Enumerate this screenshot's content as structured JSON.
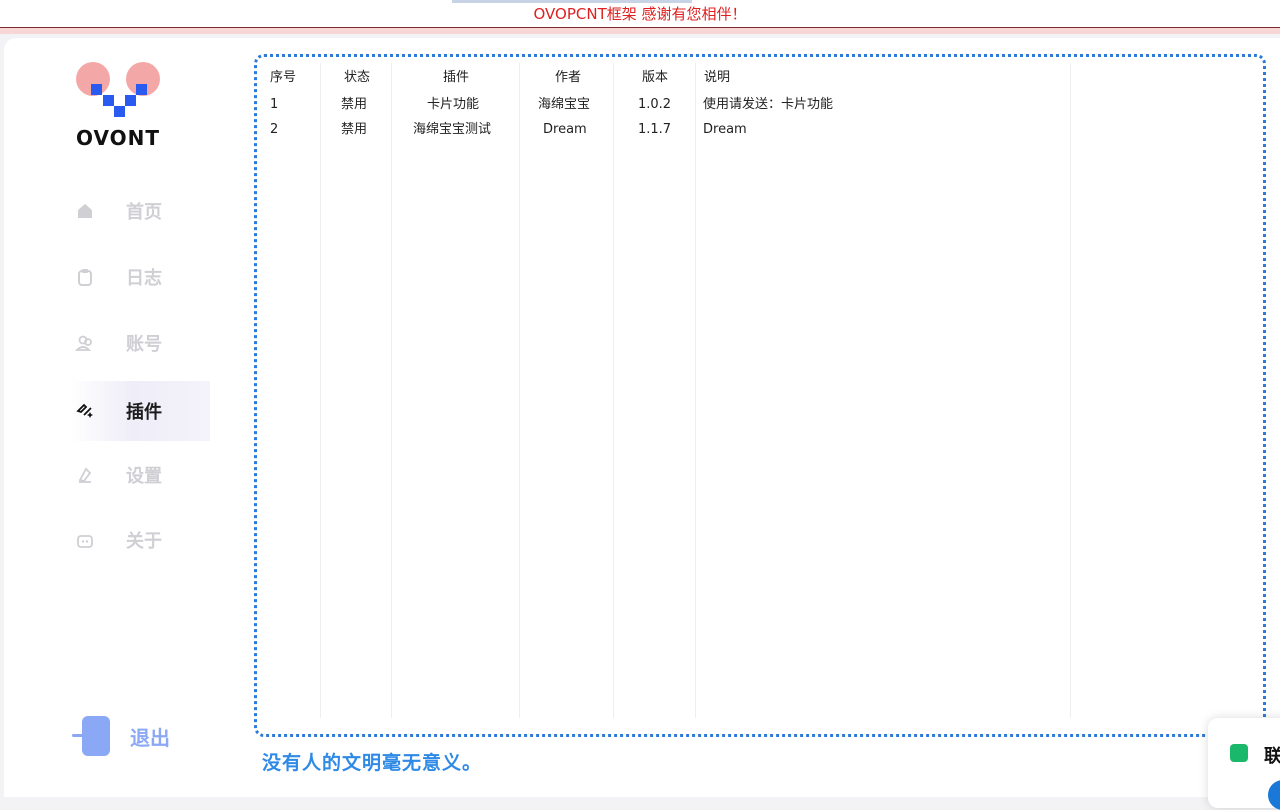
{
  "banner": {
    "message": "OVOPCNT框架 感谢有您相伴！",
    "color": "#e02020"
  },
  "sidebar": {
    "brand": "OVONT",
    "items": [
      {
        "label": "首页",
        "icon": "home-icon",
        "active": false
      },
      {
        "label": "日志",
        "icon": "clipboard-icon",
        "active": false
      },
      {
        "label": "账号",
        "icon": "users-icon",
        "active": false
      },
      {
        "label": "插件",
        "icon": "sparkle-plugin-icon",
        "active": true
      },
      {
        "label": "设置",
        "icon": "settings-icon",
        "active": false
      },
      {
        "label": "关于",
        "icon": "robot-icon",
        "active": false
      }
    ],
    "logout": "退出"
  },
  "table": {
    "headers": [
      "序号",
      "状态",
      "插件",
      "作者",
      "版本",
      "说明"
    ],
    "rows": [
      [
        "1",
        "禁用",
        "卡片功能",
        "海绵宝宝",
        "1.0.2",
        "使用请发送：卡片功能"
      ],
      [
        "2",
        "禁用",
        "海绵宝宝测试",
        "Dream",
        "1.1.7",
        "Dream"
      ]
    ]
  },
  "motto": "没有人的文明毫无意义。",
  "contact": {
    "label": "联"
  },
  "colors": {
    "accent": "#2e7ad6",
    "logo_pink": "#f4a7a7",
    "logo_blue": "#2a5bf0"
  }
}
